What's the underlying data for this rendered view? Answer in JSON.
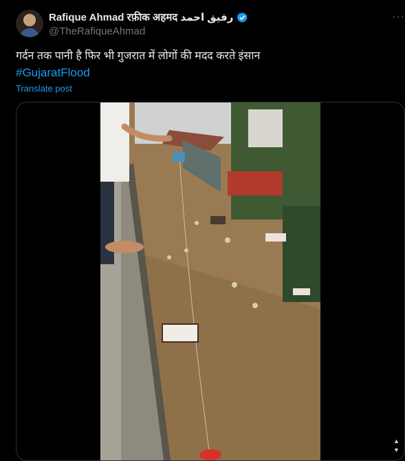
{
  "post": {
    "author_name": "Rafique Ahmad रफ़ीक अहमद رفیق احمد",
    "handle": "@TheRafiqueAhmad",
    "text": "गर्दन तक पानी है फिर भी गुजरात में लोगों की मदद करते इंसान",
    "hashtag": "#GujaratFlood",
    "translate_label": "Translate post",
    "more_label": "···"
  },
  "icons": {
    "verified": "verified-badge-icon",
    "more": "more-options-icon"
  },
  "colors": {
    "background": "#000000",
    "text": "#e7e9ea",
    "muted": "#71767b",
    "link": "#1d9bf0",
    "flood_water": "#9a7a52"
  },
  "scrollbar": {
    "up": "▲",
    "down": "▼"
  }
}
